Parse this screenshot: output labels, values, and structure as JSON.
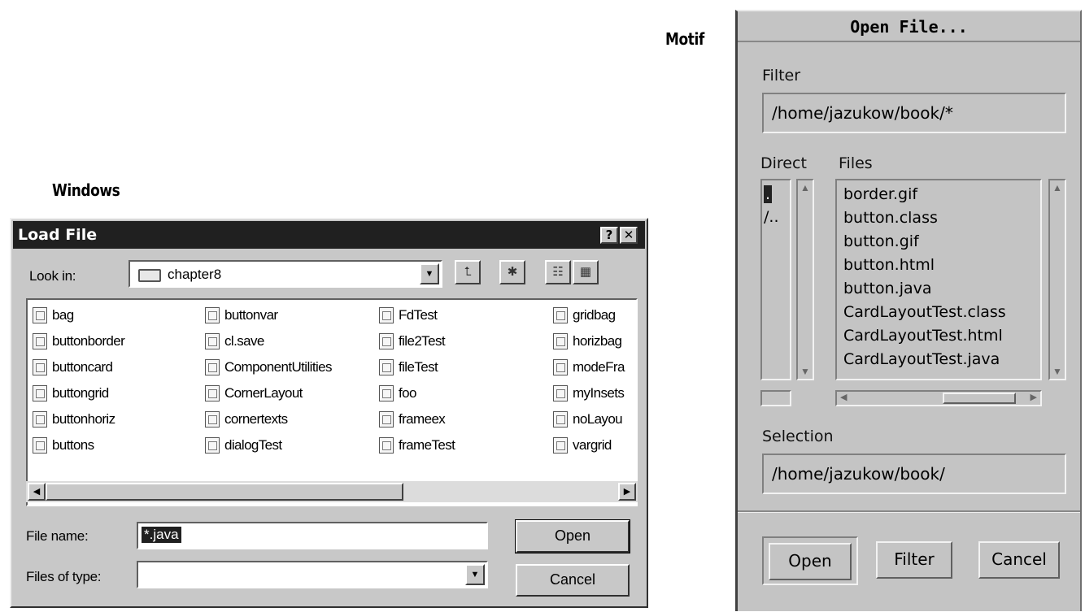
{
  "captions": {
    "windows": "Windows",
    "motif": "Motif"
  },
  "windows_dialog": {
    "title": "Load File",
    "help_button": "?",
    "close_button": "✕",
    "look_in_label": "Look in:",
    "look_in_value": "chapter8",
    "files": [
      [
        "bag",
        "buttonborder",
        "buttoncard",
        "buttongrid",
        "buttonhoriz",
        "buttons"
      ],
      [
        "buttonvar",
        "cl.save",
        "ComponentUtilities",
        "CornerLayout",
        "cornertexts",
        "dialogTest"
      ],
      [
        "FdTest",
        "file2Test",
        "fileTest",
        "foo",
        "frameex",
        "frameTest"
      ],
      [
        "gridbag",
        "horizbag",
        "modeFra",
        "myInsets",
        "noLayou",
        "vargrid"
      ]
    ],
    "file_name_label": "File name:",
    "file_name_value": "*.java",
    "files_of_type_label": "Files of type:",
    "files_of_type_value": "",
    "open_button": "Open",
    "cancel_button": "Cancel"
  },
  "motif_dialog": {
    "title": "Open File...",
    "filter_label": "Filter",
    "filter_value": "/home/jazukow/book/*",
    "directories_label": "Direct",
    "directories": [
      ".",
      "/.."
    ],
    "files_label": "Files",
    "files": [
      "border.gif",
      "button.class",
      "button.gif",
      "button.html",
      "button.java",
      "CardLayoutTest.class",
      "CardLayoutTest.html",
      "CardLayoutTest.java"
    ],
    "selection_label": "Selection",
    "selection_value": "/home/jazukow/book/",
    "open_button": "Open",
    "filter_button": "Filter",
    "cancel_button": "Cancel"
  }
}
